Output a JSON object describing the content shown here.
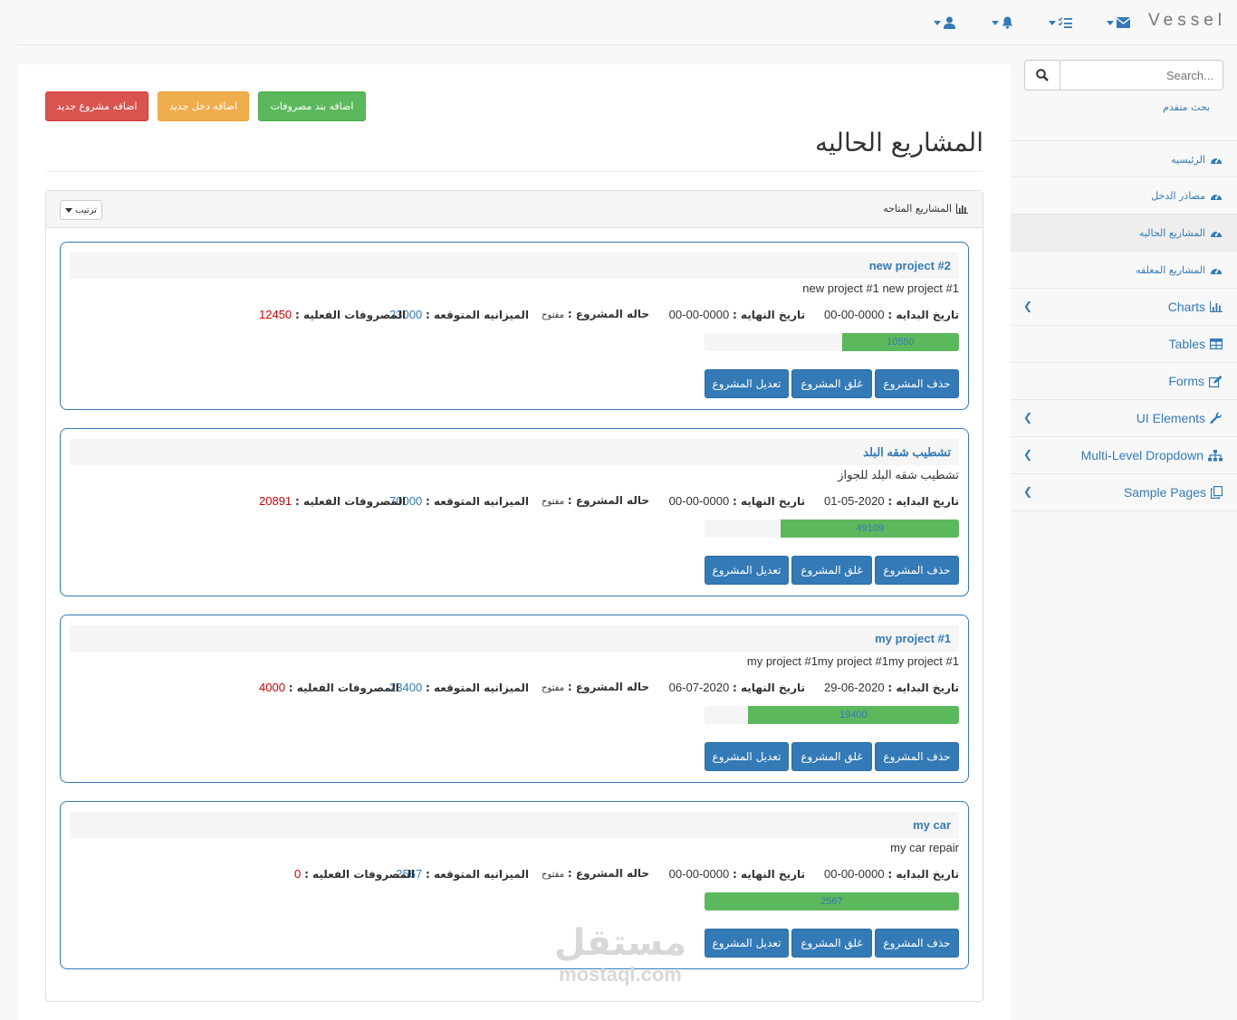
{
  "navbar": {
    "brand": "Vessel",
    "icons": [
      "envelope-icon",
      "tasks-icon",
      "bell-icon",
      "user-icon"
    ]
  },
  "actions": {
    "add_project": "اضافه مشروع جديد",
    "add_income": "اضافه دخل جديد",
    "add_expense": "اضافه بند مصروفات"
  },
  "page": {
    "title": "المشاريع الحاليه"
  },
  "panel": {
    "title": "المشاريع المتاحه",
    "sort_label": "ترتيب"
  },
  "labels": {
    "start_date": "تاريخ البدايه :",
    "end_date": "تاريخ النهايه :",
    "status": "حاله المشروع :",
    "expected_budget": "الميزانيه المتوقعه :",
    "actual_expenses": "المصروفات الفعليه :",
    "edit": "تعديل المشروع",
    "close": "غلق المشروع",
    "delete": "حذف المشروع"
  },
  "projects": [
    {
      "name": "new project #2",
      "description": "new project #1 new project #1",
      "start_date": "0000-00-00",
      "end_date": "0000-00-00",
      "status": "مفتوح",
      "budget": "23000",
      "expenses": "12450",
      "progress_value": "10550",
      "progress_fraction": 0.46
    },
    {
      "name": "تشطيب شقه البلد",
      "description": "تشطيب شقه البلد للجواز",
      "start_date": "2020-05-01",
      "end_date": "0000-00-00",
      "status": "مفتوح",
      "budget": "70000",
      "expenses": "20891",
      "progress_value": "49109",
      "progress_fraction": 0.7
    },
    {
      "name": "my project #1",
      "description": "my project #1my project #1my project #1",
      "start_date": "2020-06-29",
      "end_date": "2020-07-06",
      "status": "مفتوح",
      "budget": "23400",
      "expenses": "4000",
      "progress_value": "19400",
      "progress_fraction": 0.83
    },
    {
      "name": "my car",
      "description": "my car repair",
      "start_date": "0000-00-00",
      "end_date": "0000-00-00",
      "status": "مفتوح",
      "budget": "2567",
      "expenses": "0",
      "progress_value": "2567",
      "progress_fraction": 1.0
    }
  ],
  "sidebar": {
    "search_placeholder": "Search...",
    "advanced_search": "بحث متقدم",
    "items": [
      {
        "label": "الرئيسيه",
        "icon": "dashboard-icon",
        "submenu": false,
        "active": false
      },
      {
        "label": "مصادر الدخل",
        "icon": "dashboard-icon",
        "submenu": false,
        "active": false
      },
      {
        "label": "المشاريع الحاليه",
        "icon": "dashboard-icon",
        "submenu": false,
        "active": true
      },
      {
        "label": "المشاريع المغلقه",
        "icon": "dashboard-icon",
        "submenu": false,
        "active": false
      },
      {
        "label": "Charts",
        "icon": "bar-chart-icon",
        "submenu": true,
        "active": false
      },
      {
        "label": "Tables",
        "icon": "table-icon",
        "submenu": false,
        "active": false
      },
      {
        "label": "Forms",
        "icon": "edit-icon",
        "submenu": false,
        "active": false
      },
      {
        "label": "UI Elements",
        "icon": "wrench-icon",
        "submenu": true,
        "active": false
      },
      {
        "label": "Multi-Level Dropdown",
        "icon": "sitemap-icon",
        "submenu": true,
        "active": false
      },
      {
        "label": "Sample Pages",
        "icon": "files-icon",
        "submenu": true,
        "active": false
      }
    ]
  },
  "watermark": {
    "arabic": "مستقل",
    "latin": "mostaql.com"
  },
  "colors": {
    "primary": "#337ab7",
    "success": "#5cb85c",
    "warning": "#f0ad4e",
    "danger": "#d9534f",
    "expense_red": "#d00000"
  }
}
